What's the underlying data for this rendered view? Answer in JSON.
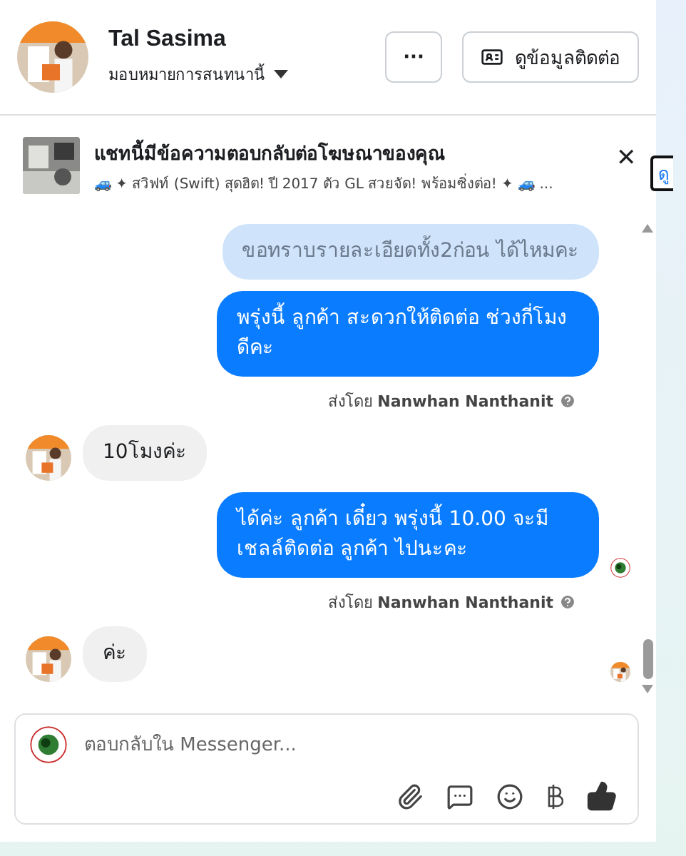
{
  "header": {
    "name": "Tal Sasima",
    "assign_label": "มอบหมายการสนทนานี้",
    "more_button": "···",
    "contact_button": "ดูข้อมูลติดต่อ"
  },
  "ad_banner": {
    "title": "แชทนี้มีข้อความตอบกลับต่อโฆษณาของคุณ",
    "subtitle": "🚙 ✦ สวิฟท์ (Swift) สุดฮิต! ปี 2017 ตัว GL สวยจัด! พร้อมซิ่งต่อ! ✦ 🚙 ...",
    "close": "✕",
    "link": "ดู"
  },
  "messages": [
    {
      "kind": "outgoing",
      "faded": true,
      "text": "ขอทราบรายละเอียดทั้ง2ก่อน ได้ไหมคะ"
    },
    {
      "kind": "outgoing",
      "faded": false,
      "text": "พรุ่งนี้ ลูกค้า  สะดวกให้ติดต่อ ช่วงกี่โมงดีคะ",
      "sent_by": "ส่งโดย **Nanwhan Nanthanit**"
    },
    {
      "kind": "incoming",
      "text": "10โมงค่ะ"
    },
    {
      "kind": "outgoing",
      "faded": false,
      "text": "ได้ค่ะ  ลูกค้า   เดี๋ยว พรุ่งนี้ 10.00 จะมีเชลล์ติดต่อ ลูกค้า  ไปนะคะ",
      "sent_by": "ส่งโดย **Nanwhan Nanthanit**",
      "seen_avatar": true
    },
    {
      "kind": "incoming",
      "text": "ค่ะ",
      "read_avatar": true
    }
  ],
  "composer": {
    "placeholder": "ตอบกลับใน Messenger..."
  }
}
